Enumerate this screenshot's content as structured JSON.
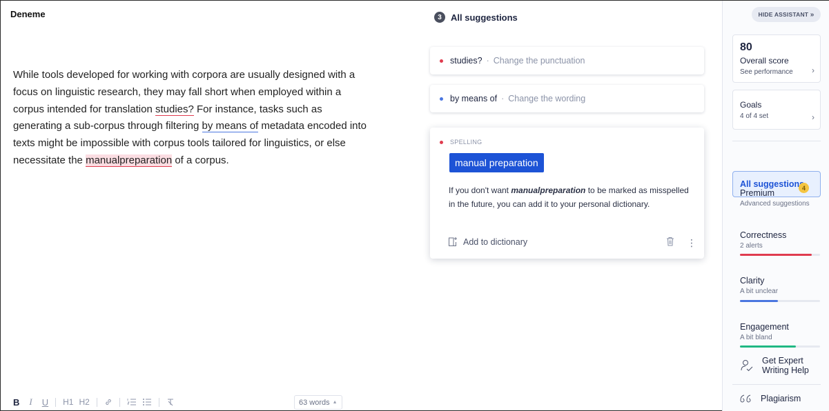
{
  "editor": {
    "doc_title": "Deneme",
    "text_before_studies": "While tools developed for working with corpora are usually designed with a focus on linguistic research, they may fall short when employed within a corpus intended for translation ",
    "mark_studies": "studies?",
    "text_after_studies": " For instance, tasks such as generating a sub-corpus through filtering ",
    "mark_by_means": "by means of",
    "text_after_by_means": " metadata encoded into texts might be impossible with corpus tools tailored for linguistics, or else necessitate the ",
    "mark_manual": "manualpreparation",
    "text_end": " of a corpus."
  },
  "toolbar": {
    "bold": "B",
    "italic": "I",
    "underline": "U",
    "h1": "H1",
    "h2": "H2",
    "word_count": "63 words",
    "word_count_arrow": "▲"
  },
  "suggestions": {
    "count": "3",
    "title": "All suggestions",
    "items": [
      {
        "key": "studies?",
        "desc": "Change the punctuation",
        "color": "#e03c4f"
      },
      {
        "key": "by means of",
        "desc": "Change the wording",
        "color": "#4a76e0"
      }
    ],
    "expanded": {
      "category": "SPELLING",
      "replacement": "manual preparation",
      "explain_before": "If you don't want ",
      "explain_word": "manualpreparation",
      "explain_after": " to be marked as misspelled in the future, you can add it to your personal dictionary.",
      "add_label": "Add to dictionary"
    }
  },
  "assistant": {
    "hide_label": "HIDE ASSISTANT",
    "hide_arrows": "»",
    "score": "80",
    "score_label": "Overall score",
    "score_sub": "See performance",
    "goals_label": "Goals",
    "goals_sub": "4 of 4 set",
    "all_suggestions": "All suggestions",
    "premium_title": "Premium",
    "premium_sub": "Advanced suggestions",
    "premium_count": "4",
    "correctness_title": "Correctness",
    "correctness_sub": "2 alerts",
    "correctness_level": 0.9,
    "correctness_color": "#e03c4f",
    "clarity_title": "Clarity",
    "clarity_sub": "A bit unclear",
    "clarity_level": 0.47,
    "clarity_color": "#4a76e0",
    "engagement_title": "Engagement",
    "engagement_sub": "A bit bland",
    "engagement_level": 0.7,
    "engagement_color": "#20b883",
    "expert_line1": "Get Expert",
    "expert_line2": "Writing Help",
    "plagiarism": "Plagiarism"
  }
}
